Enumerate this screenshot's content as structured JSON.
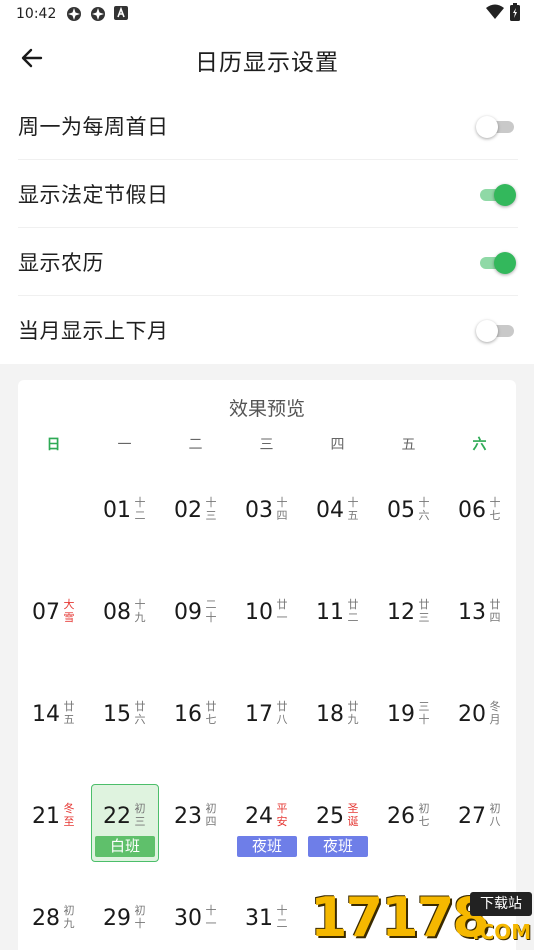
{
  "status_bar": {
    "time": "10:42",
    "icons": [
      "app-icon-1",
      "app-icon-2",
      "a-icon"
    ],
    "right_icons": [
      "wifi-icon",
      "battery-icon"
    ]
  },
  "header": {
    "title": "日历显示设置",
    "back_icon": "arrow-left-icon"
  },
  "settings": [
    {
      "label": "周一为每周首日",
      "on": false
    },
    {
      "label": "显示法定节假日",
      "on": true
    },
    {
      "label": "显示农历",
      "on": true
    },
    {
      "label": "当月显示上下月",
      "on": false
    }
  ],
  "colors": {
    "accent_green": "#33b85c",
    "track_on": "#8fd9a6",
    "track_off": "#c9c9c9",
    "holiday_red": "#e53935",
    "night_shift_blue": "#6e7ee8",
    "day_shift_green": "#5fc06b"
  },
  "preview": {
    "title": "效果预览",
    "weekdays": [
      "日",
      "一",
      "二",
      "三",
      "四",
      "五",
      "六"
    ],
    "days": [
      {
        "num": "01",
        "lunar": "十二",
        "col": 1,
        "row": 0
      },
      {
        "num": "02",
        "lunar": "十三",
        "col": 2,
        "row": 0
      },
      {
        "num": "03",
        "lunar": "十四",
        "col": 3,
        "row": 0
      },
      {
        "num": "04",
        "lunar": "十五",
        "col": 4,
        "row": 0
      },
      {
        "num": "05",
        "lunar": "十六",
        "col": 5,
        "row": 0
      },
      {
        "num": "06",
        "lunar": "十七",
        "col": 6,
        "row": 0
      },
      {
        "num": "07",
        "lunar": "大雪",
        "col": 0,
        "row": 1,
        "red": true
      },
      {
        "num": "08",
        "lunar": "十九",
        "col": 1,
        "row": 1
      },
      {
        "num": "09",
        "lunar": "二十",
        "col": 2,
        "row": 1
      },
      {
        "num": "10",
        "lunar": "廿一",
        "col": 3,
        "row": 1
      },
      {
        "num": "11",
        "lunar": "廿二",
        "col": 4,
        "row": 1
      },
      {
        "num": "12",
        "lunar": "廿三",
        "col": 5,
        "row": 1
      },
      {
        "num": "13",
        "lunar": "廿四",
        "col": 6,
        "row": 1
      },
      {
        "num": "14",
        "lunar": "廿五",
        "col": 0,
        "row": 2
      },
      {
        "num": "15",
        "lunar": "廿六",
        "col": 1,
        "row": 2
      },
      {
        "num": "16",
        "lunar": "廿七",
        "col": 2,
        "row": 2
      },
      {
        "num": "17",
        "lunar": "廿八",
        "col": 3,
        "row": 2
      },
      {
        "num": "18",
        "lunar": "廿九",
        "col": 4,
        "row": 2
      },
      {
        "num": "19",
        "lunar": "三十",
        "col": 5,
        "row": 2
      },
      {
        "num": "20",
        "lunar": "冬月",
        "col": 6,
        "row": 2
      },
      {
        "num": "21",
        "lunar": "冬至",
        "col": 0,
        "row": 3,
        "red": true
      },
      {
        "num": "22",
        "lunar": "初三",
        "col": 1,
        "row": 3,
        "selected": true,
        "badge": "白班",
        "badge_type": "day"
      },
      {
        "num": "23",
        "lunar": "初四",
        "col": 2,
        "row": 3
      },
      {
        "num": "24",
        "lunar": "平安",
        "col": 3,
        "row": 3,
        "red": true,
        "badge": "夜班",
        "badge_type": "night"
      },
      {
        "num": "25",
        "lunar": "圣诞",
        "col": 4,
        "row": 3,
        "red": true,
        "badge": "夜班",
        "badge_type": "night"
      },
      {
        "num": "26",
        "lunar": "初七",
        "col": 5,
        "row": 3
      },
      {
        "num": "27",
        "lunar": "初八",
        "col": 6,
        "row": 3
      },
      {
        "num": "28",
        "lunar": "初九",
        "col": 0,
        "row": 4
      },
      {
        "num": "29",
        "lunar": "初十",
        "col": 1,
        "row": 4
      },
      {
        "num": "30",
        "lunar": "十一",
        "col": 2,
        "row": 4
      },
      {
        "num": "31",
        "lunar": "十二",
        "col": 3,
        "row": 4
      }
    ]
  },
  "watermark": {
    "digits": "17178",
    "tag": "下载站",
    "suffix": ".COM"
  }
}
